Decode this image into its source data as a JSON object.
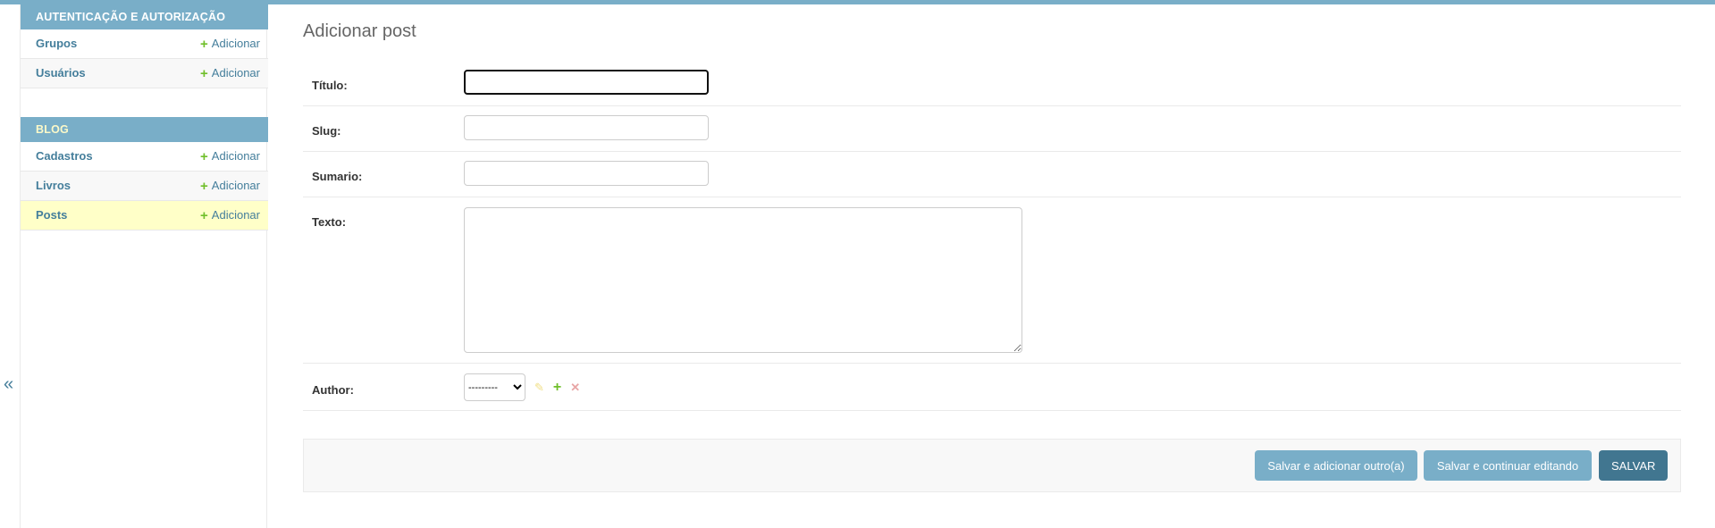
{
  "sidebar": {
    "toggle_label": "«",
    "apps": [
      {
        "name": "AUTENTICAÇÃO E AUTORIZAÇÃO",
        "models": [
          {
            "name": "Grupos",
            "add_label": "Adicionar"
          },
          {
            "name": "Usuários",
            "add_label": "Adicionar"
          }
        ]
      },
      {
        "name": "BLOG",
        "models": [
          {
            "name": "Cadastros",
            "add_label": "Adicionar"
          },
          {
            "name": "Livros",
            "add_label": "Adicionar"
          },
          {
            "name": "Posts",
            "add_label": "Adicionar",
            "selected": true
          }
        ]
      }
    ]
  },
  "main": {
    "title": "Adicionar post",
    "fields": {
      "titulo": {
        "label": "Título:",
        "value": ""
      },
      "slug": {
        "label": "Slug:",
        "value": ""
      },
      "sumario": {
        "label": "Sumario:",
        "value": ""
      },
      "texto": {
        "label": "Texto:",
        "value": ""
      },
      "author": {
        "label": "Author:",
        "selected": "---------"
      }
    },
    "buttons": {
      "add_another": "Salvar e adicionar outro(a)",
      "continue": "Salvar e continuar editando",
      "save": "SALVAR"
    }
  },
  "colors": {
    "accent": "#79aec8",
    "link": "#447e9b",
    "add_green": "#70bf2b",
    "selected_row": "#ffffc8",
    "save_button": "#417690"
  }
}
